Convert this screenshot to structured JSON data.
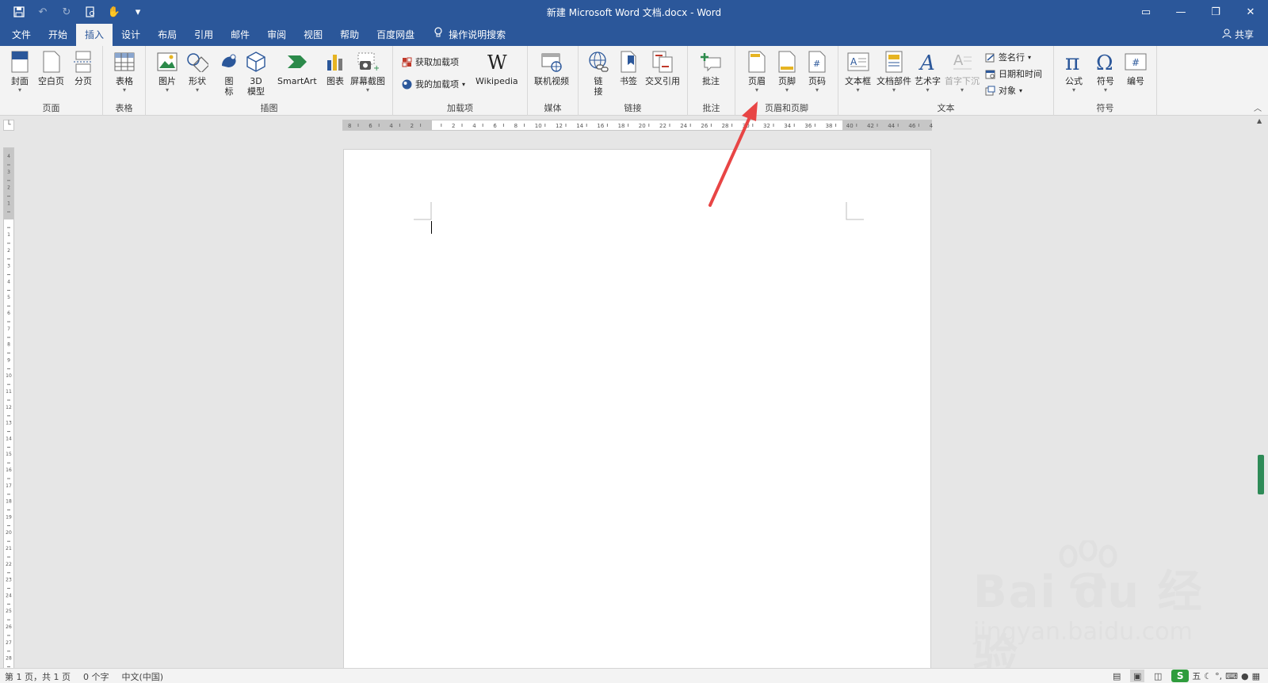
{
  "window": {
    "title": "新建 Microsoft Word 文档.docx  -  Word"
  },
  "qat": {
    "more_label": "▾"
  },
  "tabs": [
    "文件",
    "开始",
    "插入",
    "设计",
    "布局",
    "引用",
    "邮件",
    "审阅",
    "视图",
    "帮助",
    "百度网盘"
  ],
  "active_tab": "插入",
  "tellme": {
    "label": "操作说明搜索"
  },
  "share": {
    "label": "共享"
  },
  "ribbon": {
    "groups": {
      "pages": {
        "label": "页面",
        "buttons": [
          "封面",
          "空白页",
          "分页"
        ]
      },
      "tables": {
        "label": "表格",
        "buttons": [
          "表格"
        ]
      },
      "illustrations": {
        "label": "插图",
        "buttons": [
          "图片",
          "形状",
          "图\n标",
          "3D\n模型",
          "SmartArt",
          "图表",
          "屏幕截图"
        ]
      },
      "addins": {
        "label": "加载项",
        "get": "获取加载项",
        "mine": "我的加载项",
        "wikipedia": "Wikipedia"
      },
      "media": {
        "label": "媒体",
        "buttons": [
          "联机视频"
        ]
      },
      "links": {
        "label": "链接",
        "buttons": [
          "链\n接",
          "书签",
          "交叉引用"
        ]
      },
      "comments": {
        "label": "批注",
        "buttons": [
          "批注"
        ]
      },
      "header_footer": {
        "label": "页眉和页脚",
        "buttons": [
          "页眉",
          "页脚",
          "页码"
        ]
      },
      "text": {
        "label": "文本",
        "buttons": [
          "文本框",
          "文档部件",
          "艺术字",
          "首字下沉"
        ],
        "signature": "签名行",
        "datetime": "日期和时间",
        "object": "对象"
      },
      "symbols": {
        "label": "符号",
        "buttons": [
          "公式",
          "符号",
          "编号"
        ]
      }
    }
  },
  "ruler": {
    "h_ticks": [
      "8",
      "6",
      "4",
      "2",
      "",
      "2",
      "4",
      "6",
      "8",
      "10",
      "12",
      "14",
      "16",
      "18",
      "20",
      "22",
      "24",
      "26",
      "28",
      "30",
      "32",
      "34",
      "36",
      "38",
      "40",
      "42",
      "44",
      "46",
      "48"
    ],
    "v_ticks": [
      "4",
      "3",
      "2",
      "1",
      "",
      "1",
      "2",
      "3",
      "4",
      "5",
      "6",
      "7",
      "8",
      "9",
      "10",
      "11",
      "12",
      "13",
      "14",
      "15",
      "16",
      "17",
      "18",
      "19",
      "20",
      "21",
      "22",
      "23",
      "24",
      "25",
      "26",
      "27",
      "28"
    ]
  },
  "status": {
    "page": "第 1 页，共 1 页",
    "words": "0 个字",
    "language": "中文(中国)"
  },
  "ime": {
    "logo": "S",
    "mode": "五"
  },
  "watermark": {
    "big": "Bai du 经验",
    "small": "jingyan.baidu.com"
  },
  "colors": {
    "accent": "#2b579a",
    "annotation": "#e84545"
  }
}
